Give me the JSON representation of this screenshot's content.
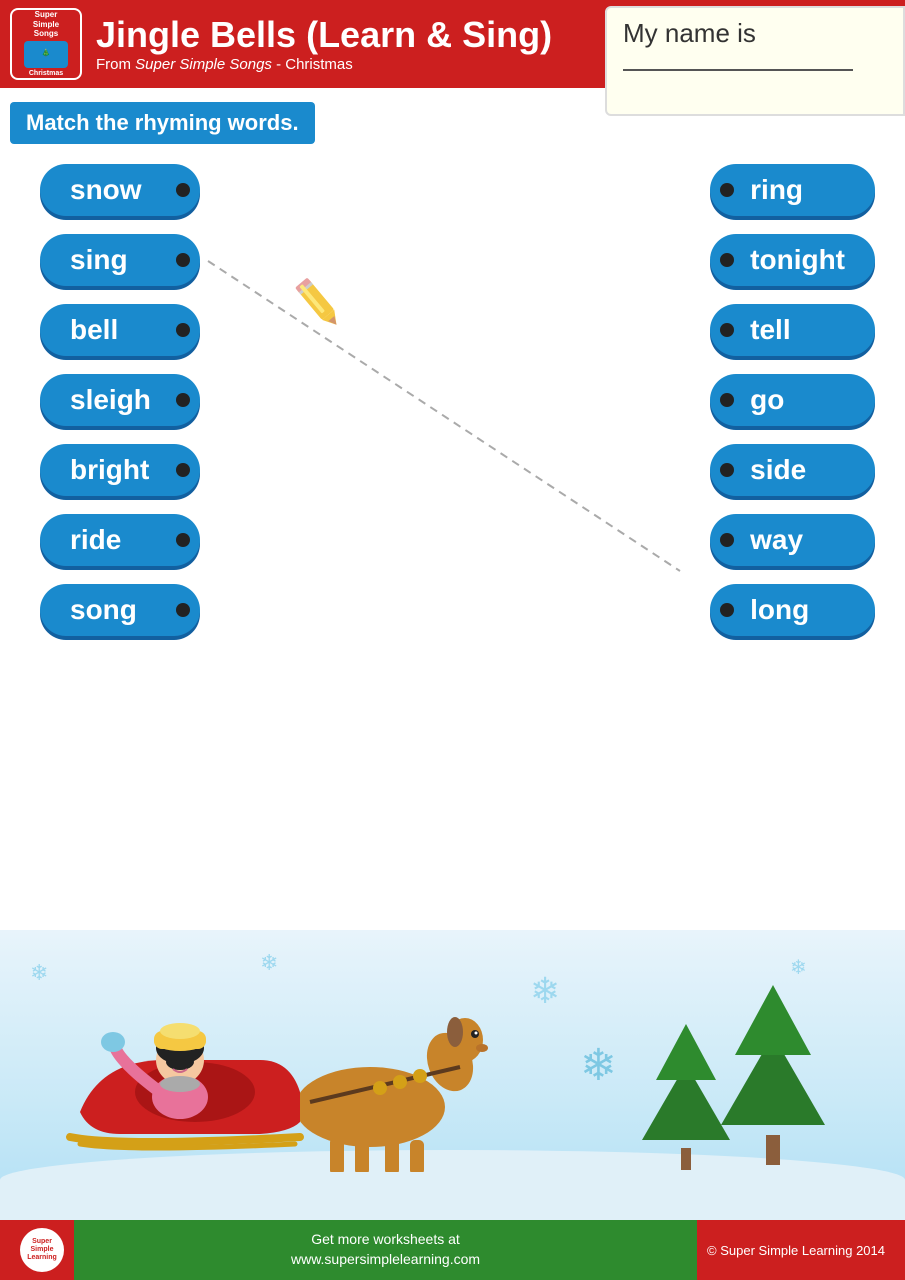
{
  "header": {
    "logo_text": "Super Simple Songs Christmas",
    "title": "Jingle Bells (Learn & Sing)",
    "subtitle_pre": "From ",
    "subtitle_brand": "Super Simple Songs",
    "subtitle_post": " - Christmas"
  },
  "name_section": {
    "label": "My name is"
  },
  "instruction": {
    "text": "Match the rhyming words."
  },
  "left_words": [
    {
      "word": "snow"
    },
    {
      "word": "sing"
    },
    {
      "word": "bell"
    },
    {
      "word": "sleigh"
    },
    {
      "word": "bright"
    },
    {
      "word": "ride"
    },
    {
      "word": "song"
    }
  ],
  "right_words": [
    {
      "word": "ring"
    },
    {
      "word": "tonight"
    },
    {
      "word": "tell"
    },
    {
      "word": "go"
    },
    {
      "word": "side"
    },
    {
      "word": "way"
    },
    {
      "word": "long"
    }
  ],
  "footer": {
    "website": "Get more worksheets at\nwww.supersimplelearning.com",
    "copyright": "© Super Simple Learning 2014"
  }
}
